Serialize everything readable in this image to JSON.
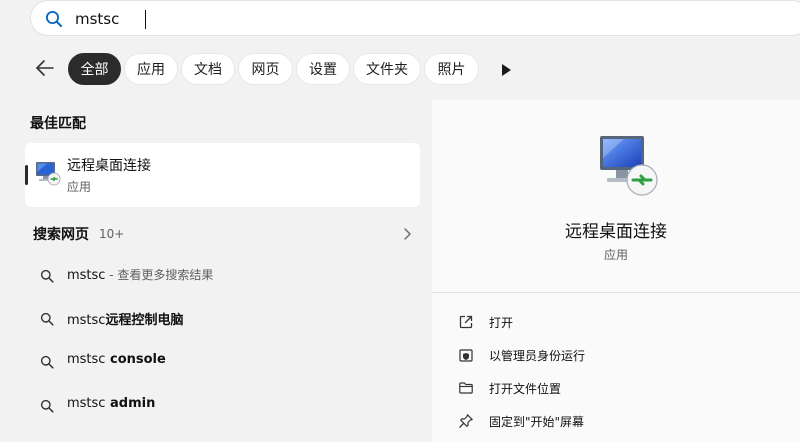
{
  "search": {
    "query": "mstsc",
    "icon": "search-icon"
  },
  "filters": {
    "back_icon": "arrow-left-icon",
    "more_icon": "play-right-icon",
    "tabs": [
      {
        "label": "全部",
        "active": true
      },
      {
        "label": "应用",
        "active": false
      },
      {
        "label": "文档",
        "active": false
      },
      {
        "label": "网页",
        "active": false
      },
      {
        "label": "设置",
        "active": false
      },
      {
        "label": "文件夹",
        "active": false
      },
      {
        "label": "照片",
        "active": false
      }
    ]
  },
  "best_match": {
    "heading": "最佳匹配",
    "title": "远程桌面连接",
    "subtitle": "应用",
    "icon": "remote-desktop-icon"
  },
  "web": {
    "heading": "搜索网页",
    "count": "10+",
    "items": [
      {
        "query": "mstsc",
        "suffix": " - 查看更多搜索结果",
        "bold_part": ""
      },
      {
        "query": "mstsc",
        "suffix": "",
        "bold_part": "远程控制电脑"
      },
      {
        "query": "mstsc",
        "suffix": "",
        "bold_part": " console"
      },
      {
        "query": "mstsc",
        "suffix": "",
        "bold_part": " admin"
      }
    ]
  },
  "detail": {
    "title": "远程桌面连接",
    "subtitle": "应用",
    "actions": [
      {
        "label": "打开",
        "icon": "open-external-icon"
      },
      {
        "label": "以管理员身份运行",
        "icon": "shield-icon"
      },
      {
        "label": "打开文件位置",
        "icon": "folder-icon"
      },
      {
        "label": "固定到\"开始\"屏幕",
        "icon": "pin-icon"
      }
    ]
  },
  "colors": {
    "accent": "#0067c0",
    "active_chip": "#2b2b2b",
    "background": "#f2f2f2",
    "panel": "#fafafa"
  }
}
